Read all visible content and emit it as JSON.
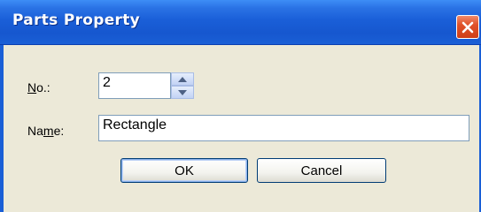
{
  "window": {
    "title": "Parts Property",
    "close_icon": "close-icon"
  },
  "form": {
    "no_label_mnemonic": "N",
    "no_label_rest": "o.:",
    "no_value": "2",
    "name_label_pre": "Na",
    "name_label_mnemonic": "m",
    "name_label_post": "e:",
    "name_value": "Rectangle"
  },
  "buttons": {
    "ok": "OK",
    "cancel": "Cancel"
  },
  "colors": {
    "titlebar": "#1a5fd6",
    "close": "#e0522a",
    "face": "#ece9d8"
  }
}
